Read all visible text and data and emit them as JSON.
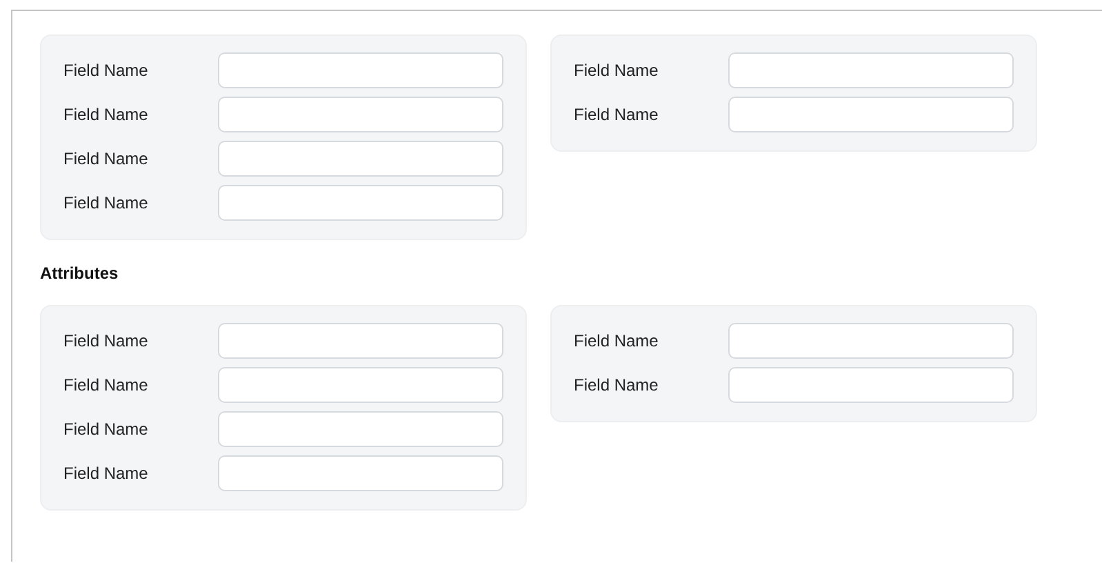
{
  "sections": [
    {
      "cards": [
        {
          "fields": [
            {
              "label": "Field Name"
            },
            {
              "label": "Field Name"
            },
            {
              "label": "Field Name"
            },
            {
              "label": "Field Name"
            }
          ]
        },
        {
          "fields": [
            {
              "label": "Field Name"
            },
            {
              "label": "Field Name"
            }
          ]
        }
      ]
    },
    {
      "heading": "Attributes",
      "cards": [
        {
          "fields": [
            {
              "label": "Field Name"
            },
            {
              "label": "Field Name"
            },
            {
              "label": "Field Name"
            },
            {
              "label": "Field Name"
            }
          ]
        },
        {
          "fields": [
            {
              "label": "Field Name"
            },
            {
              "label": "Field Name"
            }
          ]
        }
      ]
    }
  ]
}
